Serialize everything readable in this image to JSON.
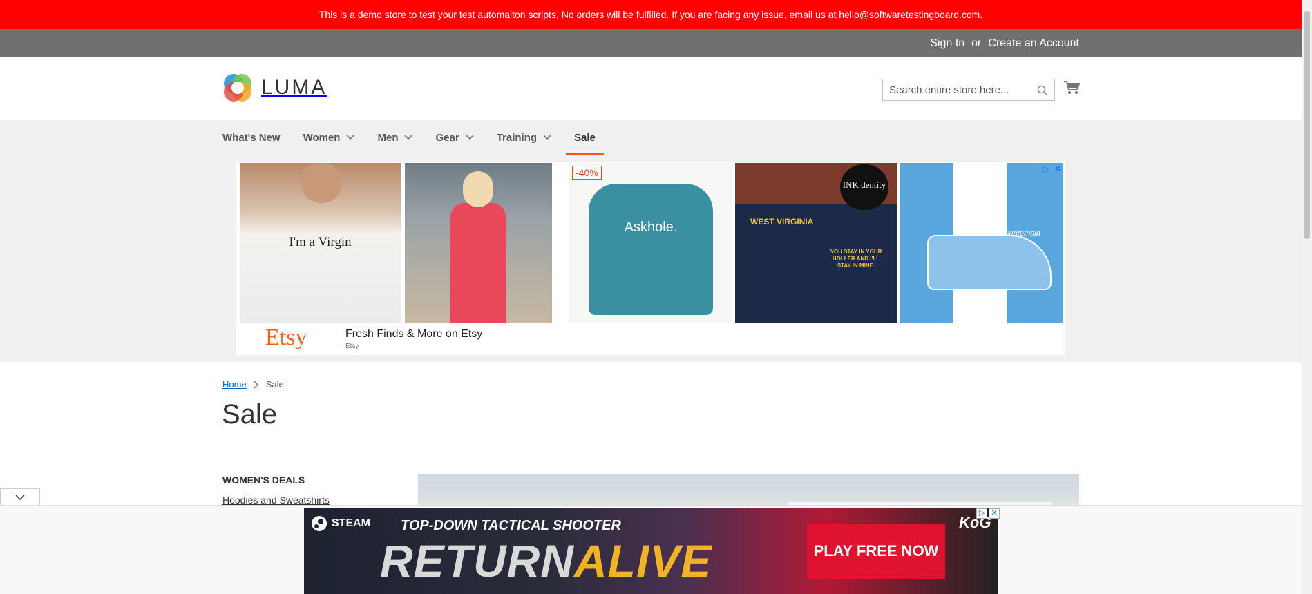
{
  "demo_notice": "This is a demo store to test your test automaiton scripts. No orders will be fulfilled. If you are facing any issue, email us at hello@softwaretestingboard.com.",
  "top_links": {
    "sign_in": "Sign In",
    "or": "or",
    "create_account": "Create an Account"
  },
  "logo": {
    "text": "LUMA"
  },
  "search": {
    "placeholder": "Search entire store here..."
  },
  "nav": {
    "items": [
      {
        "label": "What's New"
      },
      {
        "label": "Women"
      },
      {
        "label": "Men"
      },
      {
        "label": "Gear"
      },
      {
        "label": "Training"
      },
      {
        "label": "Sale"
      }
    ]
  },
  "ad_top": {
    "badge": "-40%",
    "img1_text": "I'm a Virgin",
    "img3_text": "Askhole.",
    "img4_text_a": "WEST VIRGINIA",
    "img4_text_b": "YOU STAY IN YOUR HOLLER AND I'LL STAY IN MINE.",
    "img4_brand": "INK dentity",
    "img5_text": "Guatemala",
    "logo_text": "Etsy",
    "title": "Fresh Finds & More on Etsy",
    "sponsor": "Etsy"
  },
  "breadcrumb": {
    "home": "Home",
    "current": "Sale"
  },
  "page_title": "Sale",
  "sidebar": {
    "title": "WOMEN'S DEALS",
    "link": "Hoodies and Sweatshirts"
  },
  "ad_bottom": {
    "steam": "STEAM",
    "tagline": "TOP-DOWN TACTICAL SHOOTER",
    "title_a": "RETURN",
    "title_b": "ALIVE",
    "cta": "PLAY FREE NOW",
    "brand": "KoG"
  },
  "colors": {
    "demo_bar": "#ff0101",
    "top_bar": "#6e716e",
    "accent": "#ff5501",
    "link": "#006bb4",
    "etsy": "#f1641e"
  }
}
